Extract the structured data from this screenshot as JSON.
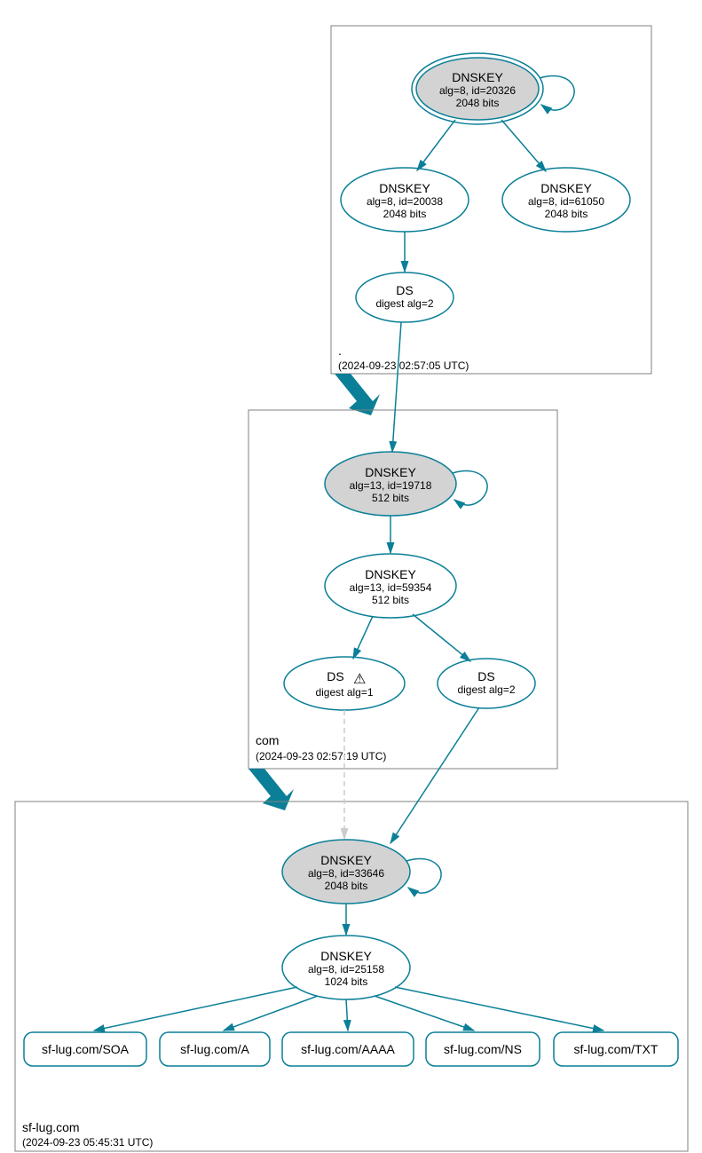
{
  "zones": {
    "root": {
      "label": ".",
      "timestamp": "(2024-09-23 02:57:05 UTC)"
    },
    "com": {
      "label": "com",
      "timestamp": "(2024-09-23 02:57:19 UTC)"
    },
    "leaf": {
      "label": "sf-lug.com",
      "timestamp": "(2024-09-23 05:45:31 UTC)"
    }
  },
  "nodes": {
    "root_ksk": {
      "title": "DNSKEY",
      "line1": "alg=8, id=20326",
      "line2": "2048 bits"
    },
    "root_zsk1": {
      "title": "DNSKEY",
      "line1": "alg=8, id=20038",
      "line2": "2048 bits"
    },
    "root_zsk2": {
      "title": "DNSKEY",
      "line1": "alg=8, id=61050",
      "line2": "2048 bits"
    },
    "root_ds": {
      "title": "DS",
      "line1": "digest alg=2"
    },
    "com_ksk": {
      "title": "DNSKEY",
      "line1": "alg=13, id=19718",
      "line2": "512 bits"
    },
    "com_zsk": {
      "title": "DNSKEY",
      "line1": "alg=13, id=59354",
      "line2": "512 bits"
    },
    "com_ds1": {
      "title": "DS",
      "warn": "⚠",
      "line1": "digest alg=1"
    },
    "com_ds2": {
      "title": "DS",
      "line1": "digest alg=2"
    },
    "leaf_ksk": {
      "title": "DNSKEY",
      "line1": "alg=8, id=33646",
      "line2": "2048 bits"
    },
    "leaf_zsk": {
      "title": "DNSKEY",
      "line1": "alg=8, id=25158",
      "line2": "1024 bits"
    },
    "rr_soa": {
      "label": "sf-lug.com/SOA"
    },
    "rr_a": {
      "label": "sf-lug.com/A"
    },
    "rr_aaaa": {
      "label": "sf-lug.com/AAAA"
    },
    "rr_ns": {
      "label": "sf-lug.com/NS"
    },
    "rr_txt": {
      "label": "sf-lug.com/TXT"
    }
  }
}
